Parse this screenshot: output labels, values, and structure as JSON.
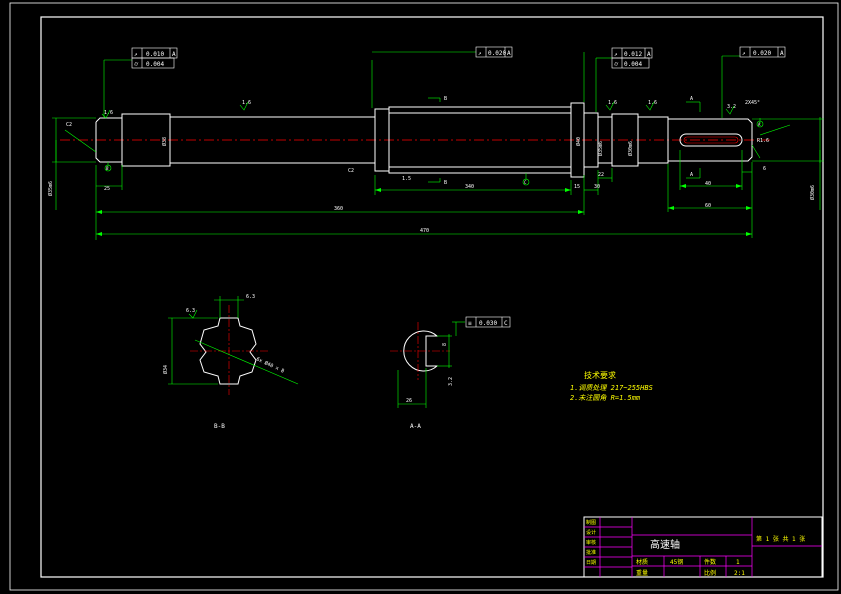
{
  "drawing": {
    "title": "高速轴",
    "material": "45钢",
    "scale": "2:1",
    "quantity": "1",
    "sheet_text": "第 1 张 共 1 张",
    "title_block_labels": {
      "material_label": "材质",
      "quantity_label": "件数",
      "weight_label": "重量",
      "scale_label": "比例",
      "designer": "设计",
      "checker": "审核",
      "approver": "批准",
      "drafter": "制图",
      "date": "日期"
    }
  },
  "tech_requirements": {
    "heading": "技术要求",
    "items": [
      "1.调质处理 217~255HBS",
      "2.未注圆角 R=1.5mm"
    ]
  },
  "tolerance_frames": [
    {
      "symbol": "↗",
      "value": "0.010",
      "datum": "A"
    },
    {
      "symbol": "⌭",
      "value": "0.004",
      "datum": ""
    },
    {
      "symbol": "↗",
      "value": "0.020",
      "datum": "A"
    },
    {
      "symbol": "↗",
      "value": "0.012",
      "datum": "A"
    },
    {
      "symbol": "⌭",
      "value": "0.004",
      "datum": ""
    },
    {
      "symbol": "↗",
      "value": "0.020",
      "datum": "A"
    },
    {
      "symbol": "≡",
      "value": "0.030",
      "datum": "C"
    }
  ],
  "dimensions": {
    "d_left_end": "25",
    "len_total": "470",
    "len_360": "360",
    "len_340": "340",
    "len_1_5": "1.5",
    "len_15": "15",
    "len_30": "30",
    "len_22": "22",
    "len_40": "40",
    "len_6": "6",
    "len_60": "60",
    "d_body": "Ø38",
    "d_bearing_left": "Ø35m6",
    "d_bearing_right": "Ø35m6",
    "d_spline": "Ø40",
    "d_output": "Ø30m6",
    "chamfer_left": "C2",
    "chamfer_right": "2X45°",
    "fillet": "R1.6",
    "roughness_1": "1.6",
    "roughness_2": "1.6",
    "roughness_3": "3.2",
    "roughness_4": "1.6",
    "roughness_5": "1.6",
    "roughness_6": "3.2"
  },
  "markers": {
    "A": "A",
    "B": "B",
    "C": "C",
    "section_BB": "B-B",
    "section_AA": "A-A"
  },
  "section_labels": {
    "bb_dim_spline": "6x Ø40 x 8",
    "bb_dim_depth": "Ø34",
    "bb_roughness": "6.3",
    "aa_width": "8",
    "aa_depth": "26",
    "aa_roughness": "3.2"
  },
  "colors": {
    "background": "#000000",
    "frame": "#ffffff",
    "dimension": "#00ff00",
    "centerline": "#ff0000",
    "outline": "#ffffff",
    "title_block": "#ff00ff",
    "annotation": "#ffff00"
  }
}
